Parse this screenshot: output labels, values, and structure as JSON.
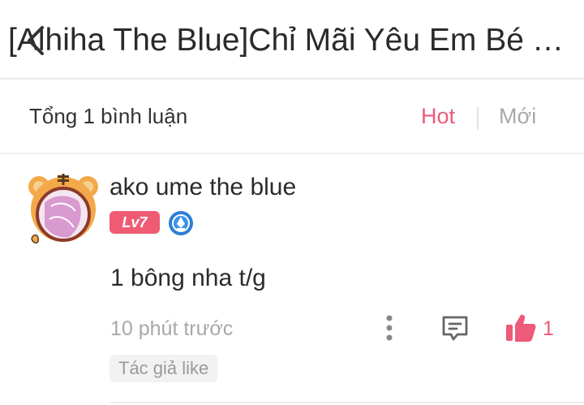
{
  "header": {
    "title": "[Alhiha The Blue]Chỉ Mãi Yêu Em Bé Tiểu Sư Muội"
  },
  "comments_bar": {
    "count_label": "Tổng 1 bình luận",
    "tabs": [
      {
        "label": "Hot",
        "active": true
      },
      {
        "label": "Mới",
        "active": false
      }
    ]
  },
  "comment": {
    "username": "ako ume the blue",
    "level": "Lv7",
    "text": "1 bông nha t/g",
    "time": "10 phút trước",
    "like_count": "1",
    "author_liked": "Tác giả like"
  },
  "colors": {
    "accent": "#ee5a7a",
    "level_badge": "#ef5b73",
    "muted": "#a8a8a8"
  },
  "icons": {
    "back": "back-icon",
    "more": "more-icon",
    "reply": "reply-icon",
    "like": "thumbs-up-icon",
    "author_badge": "author-badge-icon",
    "avatar": "tiger-avatar"
  }
}
